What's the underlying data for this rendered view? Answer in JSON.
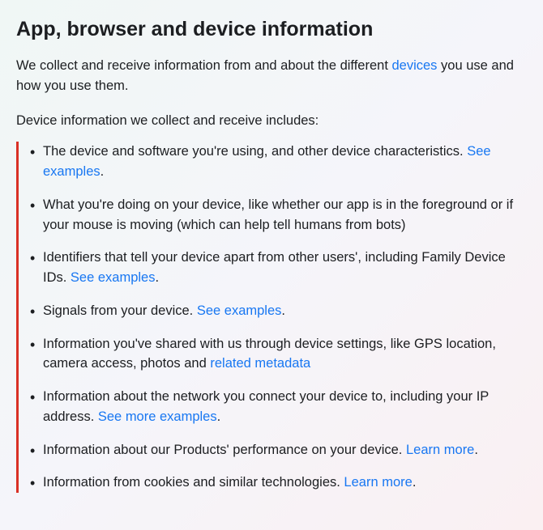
{
  "heading": "App, browser and device information",
  "intro_before": "We collect and receive information from and about the different ",
  "intro_link": "devices",
  "intro_after": " you use and how you use them.",
  "subheading": "Device information we collect and receive includes:",
  "items": [
    {
      "text_before": "The device and software you're using, and other device characteristics. ",
      "link": "See examples",
      "text_after": "."
    },
    {
      "text_before": "What you're doing on your device, like whether our app is in the foreground or if your mouse is moving (which can help tell humans from bots)",
      "link": "",
      "text_after": ""
    },
    {
      "text_before": "Identifiers that tell your device apart from other users', including Family Device IDs. ",
      "link": "See examples",
      "text_after": "."
    },
    {
      "text_before": "Signals from your device. ",
      "link": "See examples",
      "text_after": "."
    },
    {
      "text_before": "Information you've shared with us through device settings, like GPS location, camera access, photos and ",
      "link": "related metadata",
      "text_after": ""
    },
    {
      "text_before": "Information about the network you connect your device to, including your IP address. ",
      "link": "See more examples",
      "text_after": "."
    },
    {
      "text_before": "Information about our Products' performance on your device. ",
      "link": "Learn more",
      "text_after": "."
    },
    {
      "text_before": "Information from cookies and similar technologies. ",
      "link": "Learn more",
      "text_after": "."
    }
  ]
}
